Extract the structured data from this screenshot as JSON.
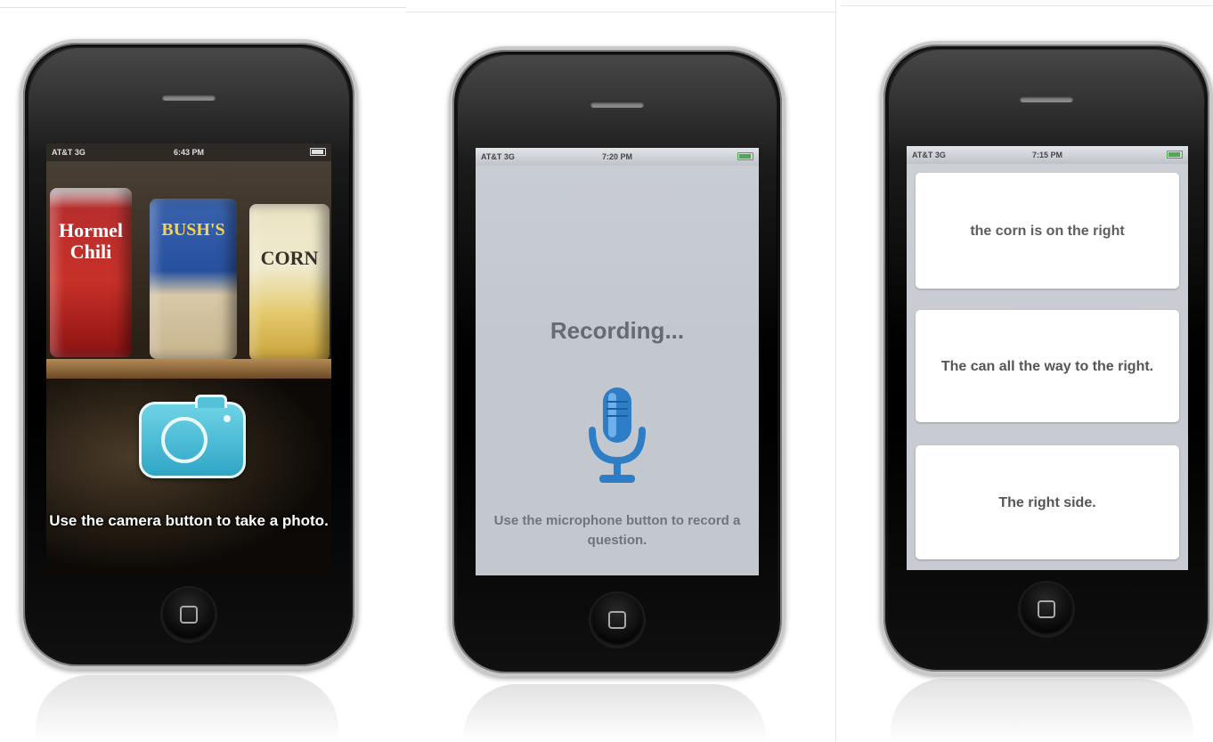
{
  "phones": [
    {
      "status": {
        "carrier": "AT&T 3G",
        "time": "6:43 PM"
      },
      "cans": [
        "Hormel Chili",
        "BUSH'S",
        "CORN"
      ],
      "overlay_text": "Use the camera button to take a photo."
    },
    {
      "status": {
        "carrier": "AT&T 3G",
        "time": "7:20 PM"
      },
      "title": "Recording...",
      "hint": "Use the microphone button to record a question."
    },
    {
      "status": {
        "carrier": "AT&T 3G",
        "time": "7:15 PM"
      },
      "answers": [
        "the corn is on the right",
        "The can all the way to the right.",
        "The right side."
      ]
    }
  ],
  "colors": {
    "camera_button": "#3bb4d2",
    "mic": "#2e7ec7",
    "recording_screen": "#c3c8cf"
  }
}
